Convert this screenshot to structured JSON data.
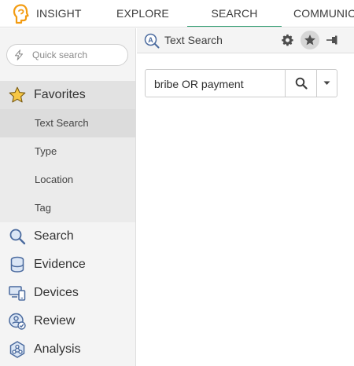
{
  "topnav": {
    "brand_icon": "brand-head-icon",
    "tabs": [
      {
        "label": "INSIGHT"
      },
      {
        "label": "EXPLORE"
      },
      {
        "label": "SEARCH",
        "active": true
      },
      {
        "label": "COMMUNIC"
      }
    ],
    "active_color": "#2e9e72"
  },
  "sidebar": {
    "quick_search": {
      "placeholder": "Quick search",
      "icon": "bolt-icon"
    },
    "favorites": {
      "label": "Favorites",
      "icon": "star-icon",
      "icon_color": "#f5c518",
      "items": [
        {
          "label": "Text Search",
          "active": true
        },
        {
          "label": "Type"
        },
        {
          "label": "Location"
        },
        {
          "label": "Tag"
        }
      ]
    },
    "items": [
      {
        "label": "Search",
        "icon": "magnifier-icon"
      },
      {
        "label": "Evidence",
        "icon": "database-icon"
      },
      {
        "label": "Devices",
        "icon": "devices-icon"
      },
      {
        "label": "Review",
        "icon": "review-icon"
      },
      {
        "label": "Analysis",
        "icon": "analysis-icon"
      }
    ],
    "icon_color": "#4a6a9e"
  },
  "panel": {
    "title": "Text Search",
    "title_icon": "text-search-icon",
    "actions": [
      "gear-icon",
      "star-icon",
      "pin-icon"
    ],
    "search": {
      "value": "bribe OR payment",
      "button_icon": "search-icon",
      "dropdown_icon": "caret-down-icon"
    }
  }
}
